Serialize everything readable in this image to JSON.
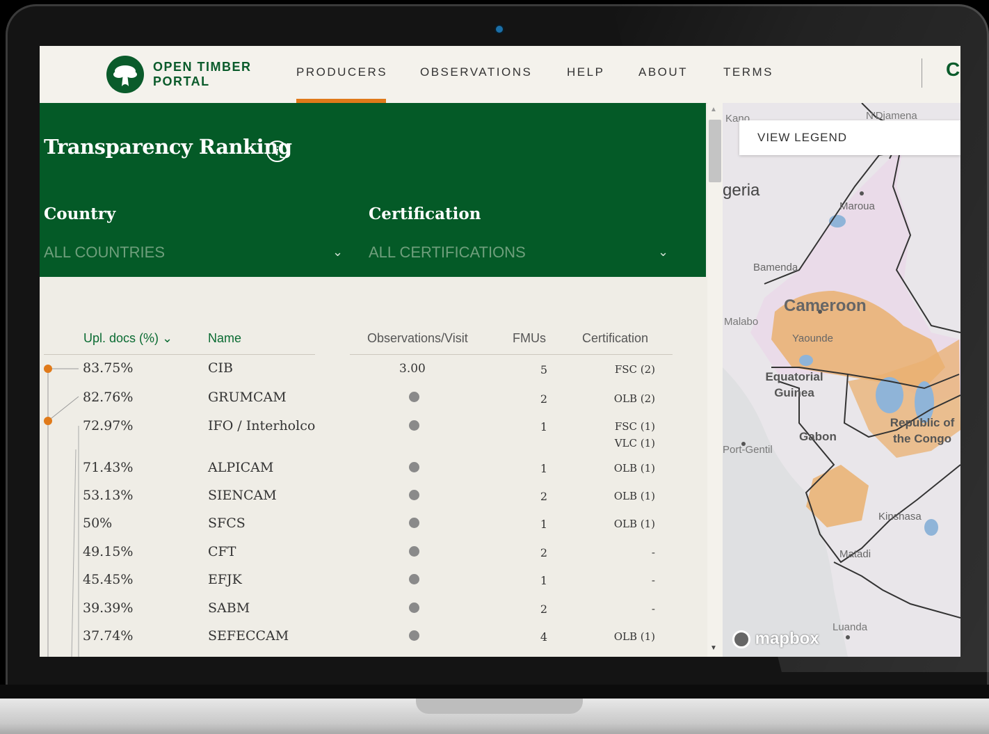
{
  "brand": {
    "line1": "OPEN TIMBER",
    "line2": "PORTAL"
  },
  "nav": {
    "items": [
      "PRODUCERS",
      "OBSERVATIONS",
      "HELP",
      "ABOUT",
      "TERMS"
    ],
    "active": "PRODUCERS",
    "extra": "C"
  },
  "panel": {
    "title": "Transparency Ranking",
    "info_glyph": "i",
    "country_label": "Country",
    "country_value": "ALL COUNTRIES",
    "cert_label": "Certification",
    "cert_value": "ALL CERTIFICATIONS"
  },
  "table": {
    "headers": {
      "docs": "Upl. docs (%) ⌄",
      "name": "Name",
      "obs": "Observations/Visit",
      "fmus": "FMUs",
      "cert": "Certification"
    },
    "rows": [
      {
        "docs": "83.75%",
        "name": "CIB",
        "obs": "3.00",
        "fmus": "5",
        "cert": [
          "FSC (2)"
        ]
      },
      {
        "docs": "82.76%",
        "name": "GRUMCAM",
        "obs": "",
        "fmus": "2",
        "cert": [
          "OLB (2)"
        ]
      },
      {
        "docs": "72.97%",
        "name": "IFO / Interholco",
        "obs": "",
        "fmus": "1",
        "cert": [
          "FSC (1)",
          "VLC (1)"
        ]
      },
      {
        "docs": "71.43%",
        "name": "ALPICAM",
        "obs": "",
        "fmus": "1",
        "cert": [
          "OLB (1)"
        ]
      },
      {
        "docs": "53.13%",
        "name": "SIENCAM",
        "obs": "",
        "fmus": "2",
        "cert": [
          "OLB (1)"
        ]
      },
      {
        "docs": "50%",
        "name": "SFCS",
        "obs": "",
        "fmus": "1",
        "cert": [
          "OLB (1)"
        ]
      },
      {
        "docs": "49.15%",
        "name": "CFT",
        "obs": "",
        "fmus": "2",
        "cert": [
          "-"
        ]
      },
      {
        "docs": "45.45%",
        "name": "EFJK",
        "obs": "",
        "fmus": "1",
        "cert": [
          "-"
        ]
      },
      {
        "docs": "39.39%",
        "name": "SABM",
        "obs": "",
        "fmus": "2",
        "cert": [
          "-"
        ]
      },
      {
        "docs": "37.74%",
        "name": "SEFECCAM",
        "obs": "",
        "fmus": "4",
        "cert": [
          "OLB (1)"
        ]
      }
    ]
  },
  "map": {
    "legend_button": "VIEW LEGEND",
    "labels": [
      "Kano",
      "N'Djamena",
      "Maroua",
      "Bamenda",
      "Cameroon",
      "Yaounde",
      "Equatorial Guinea",
      "Gabon",
      "Republic of the Congo",
      "Kinshasa",
      "Matadi",
      "Luanda",
      "Malabo",
      "Port-Gentil"
    ],
    "partial_labels": [
      "geria"
    ],
    "attribution": "mapbox"
  }
}
